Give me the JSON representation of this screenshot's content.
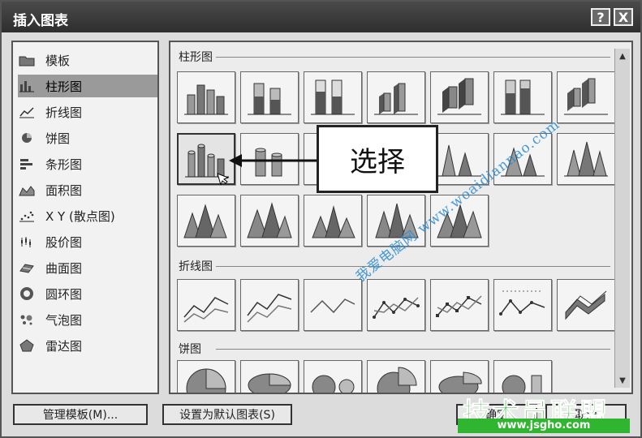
{
  "window": {
    "title": "插入图表",
    "help": "?",
    "close": "X"
  },
  "categories": [
    {
      "label": "模板",
      "icon": "folder-icon"
    },
    {
      "label": "柱形图",
      "icon": "column-chart-icon",
      "selected": true
    },
    {
      "label": "折线图",
      "icon": "line-chart-icon"
    },
    {
      "label": "饼图",
      "icon": "pie-chart-icon"
    },
    {
      "label": "条形图",
      "icon": "bar-chart-icon"
    },
    {
      "label": "面积图",
      "icon": "area-chart-icon"
    },
    {
      "label": "X Y (散点图)",
      "icon": "scatter-chart-icon"
    },
    {
      "label": "股价图",
      "icon": "stock-chart-icon"
    },
    {
      "label": "曲面图",
      "icon": "surface-chart-icon"
    },
    {
      "label": "圆环图",
      "icon": "doughnut-chart-icon"
    },
    {
      "label": "气泡图",
      "icon": "bubble-chart-icon"
    },
    {
      "label": "雷达图",
      "icon": "radar-chart-icon"
    }
  ],
  "sections": {
    "column": {
      "label": "柱形图"
    },
    "line": {
      "label": "折线图"
    },
    "pie": {
      "label": "饼图"
    }
  },
  "callout": {
    "text": "选择"
  },
  "buttons": {
    "manage": "管理模板(M)...",
    "set_default": "设置为默认图表(S)",
    "ok": "确定",
    "cancel": "取消"
  },
  "watermark": {
    "url_text": "我爱电脑网 www.woaidiannao.com",
    "logo_text": "技术员联盟",
    "logo_url": "www.jsgho.com"
  }
}
